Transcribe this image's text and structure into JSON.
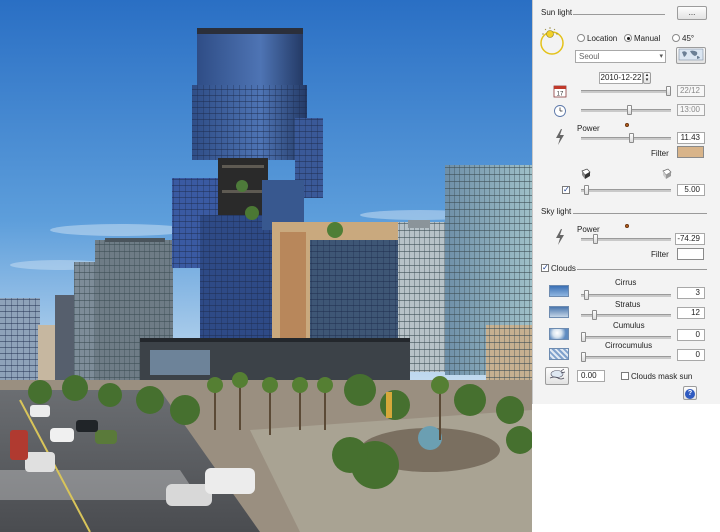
{
  "sun_light": {
    "title": "Sun light",
    "more_button": "...",
    "mode_options": [
      "Location",
      "Manual",
      "45°"
    ],
    "selected_mode": "Manual",
    "city_select": "Seoul",
    "date_value": "2010-12-22",
    "date_field": "22/12",
    "time_field": "13:00",
    "power_label": "Power",
    "power_value": "11.43",
    "filter_label": "Filter",
    "filter_color": "#d8b48a",
    "shadow_value": "5.00"
  },
  "sky_light": {
    "title": "Sky light",
    "power_label": "Power",
    "power_value": "-74.29",
    "filter_label": "Filter",
    "filter_color": "#ffffff"
  },
  "clouds": {
    "title": "Clouds",
    "enabled": true,
    "layers": [
      {
        "label": "Cirrus",
        "value": "3"
      },
      {
        "label": "Stratus",
        "value": "12"
      },
      {
        "label": "Cumulus",
        "value": "0"
      },
      {
        "label": "Cirrocumulus",
        "value": "0"
      }
    ],
    "wind_value": "0.00",
    "mask_sun_label": "Clouds mask sun",
    "mask_sun_checked": false
  },
  "help_button": "?",
  "colors": {
    "panel_bg": "#f3f3f3",
    "sky_top": "#2d74c7",
    "sky_bottom": "#cfe2f2",
    "accent": "#1b3e8f"
  }
}
